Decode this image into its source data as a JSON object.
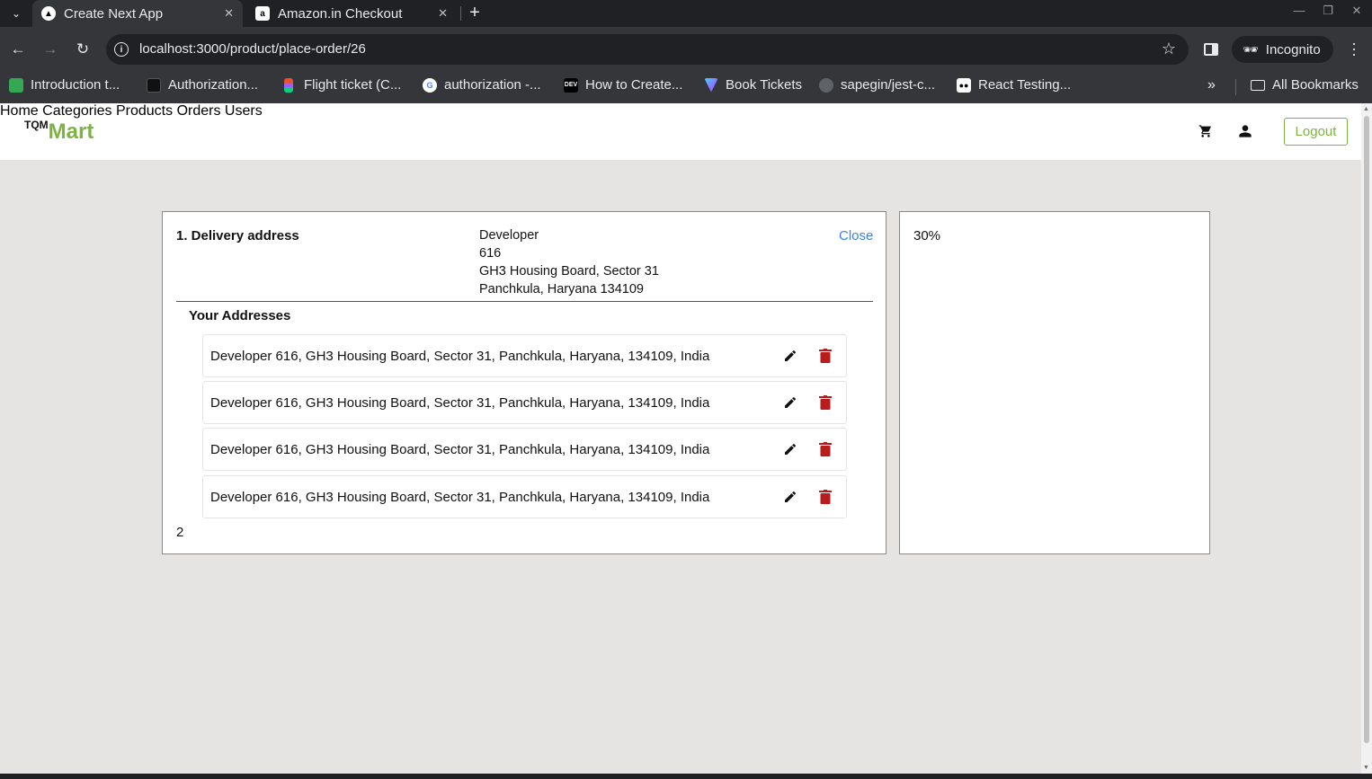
{
  "browser": {
    "tabs": [
      {
        "title": "Create Next App",
        "active": true,
        "favicon": "nextjs-icon"
      },
      {
        "title": "Amazon.in Checkout",
        "active": false,
        "favicon": "amazon-icon"
      }
    ],
    "url": "localhost:3000/product/place-order/26",
    "profile_label": "Incognito",
    "bookmarks": [
      {
        "label": "Introduction t...",
        "icon": "cube-icon",
        "color": "#34a853"
      },
      {
        "label": "Authorization...",
        "icon": "doc-icon",
        "color": "#111111"
      },
      {
        "label": "Flight ticket (C...",
        "icon": "figma-icon",
        "color": "#f24e1e"
      },
      {
        "label": "authorization -...",
        "icon": "google-icon",
        "color": "#4285f4"
      },
      {
        "label": "How to Create...",
        "icon": "dev-icon",
        "color": "#111111"
      },
      {
        "label": "Book Tickets",
        "icon": "vite-icon",
        "color": "#a855f7"
      },
      {
        "label": "sapegin/jest-c...",
        "icon": "github-icon",
        "color": "#9aa0a6"
      },
      {
        "label": "React Testing...",
        "icon": "medium-icon",
        "color": "#ffffff"
      }
    ],
    "all_bookmarks_label": "All Bookmarks"
  },
  "site": {
    "logo_prefix": "TQM",
    "logo_main": "Mart",
    "brand_color": "#7cb342",
    "nav": [
      {
        "label": "Home"
      },
      {
        "label": "Categories"
      },
      {
        "label": "Products"
      },
      {
        "label": "Orders"
      },
      {
        "label": "Users"
      }
    ],
    "logout_label": "Logout"
  },
  "checkout": {
    "step_title": "1. Delivery address",
    "selected_address": {
      "name": "Developer",
      "line1": "616",
      "line2": "GH3 Housing Board, Sector 31",
      "line3": "Panchkula, Haryana 134109"
    },
    "close_label": "Close",
    "addresses_title": "Your Addresses",
    "addresses": [
      "Developer 616, GH3 Housing Board, Sector 31, Panchkula, Haryana, 134109, India",
      "Developer 616, GH3 Housing Board, Sector 31, Panchkula, Haryana, 134109, India",
      "Developer 616, GH3 Housing Board, Sector 31, Panchkula, Haryana, 134109, India",
      "Developer 616, GH3 Housing Board, Sector 31, Panchkula, Haryana, 134109, India"
    ],
    "page_number": "2"
  },
  "summary": {
    "progress_text": "30%"
  },
  "colors": {
    "link": "#3b82f6",
    "delete": "#b91c1c"
  }
}
